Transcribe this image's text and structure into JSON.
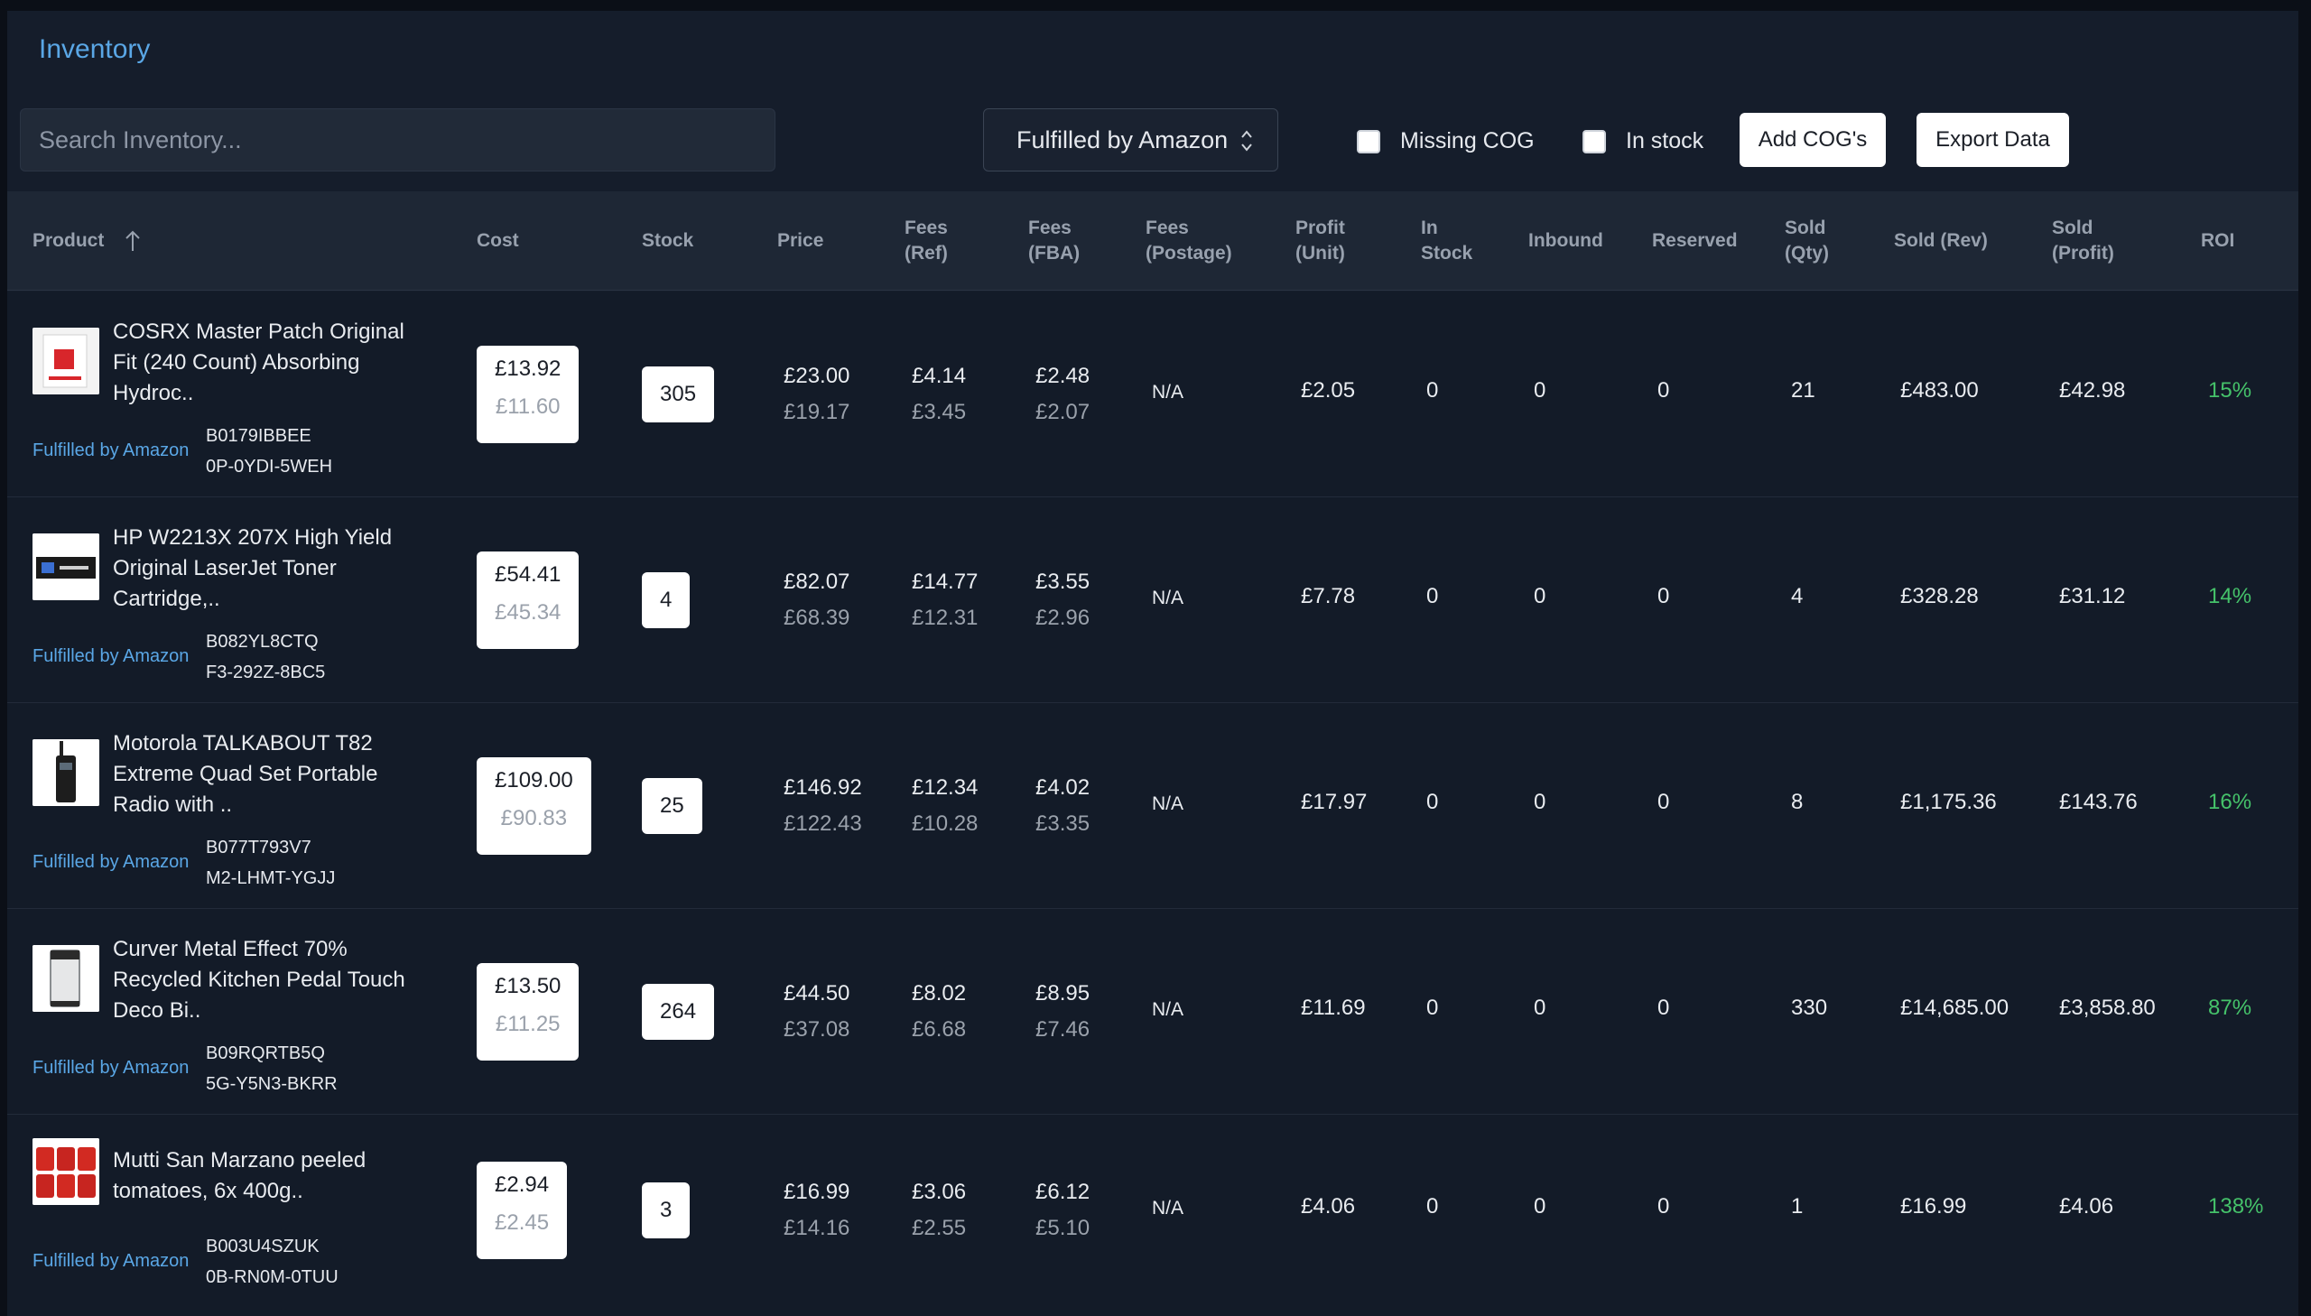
{
  "page": {
    "title": "Inventory"
  },
  "toolbar": {
    "search_placeholder": "Search Inventory...",
    "filter_value": "Fulfilled by Amazon",
    "missing_cog_label": "Missing COG",
    "in_stock_label": "In stock",
    "add_cogs_label": "Add COG's",
    "export_label": "Export Data"
  },
  "columns": {
    "product": "Product",
    "cost": "Cost",
    "stock": "Stock",
    "price": "Price",
    "fees_ref": [
      "Fees",
      "(Ref)"
    ],
    "fees_fba": [
      "Fees",
      "(FBA)"
    ],
    "fees_postage": [
      "Fees",
      "(Postage)"
    ],
    "profit_unit": [
      "Profit",
      "(Unit)"
    ],
    "in_stock": [
      "In",
      "Stock"
    ],
    "inbound": "Inbound",
    "reserved": "Reserved",
    "sold_qty": [
      "Sold",
      "(Qty)"
    ],
    "sold_rev": "Sold (Rev)",
    "sold_profit": [
      "Sold",
      "(Profit)"
    ],
    "roi": "ROI"
  },
  "rows": [
    {
      "name_lines": [
        "COSRX Master Patch Original",
        "Fit (240 Count) Absorbing",
        "Hydroc.."
      ],
      "fulfillment": "Fulfilled by Amazon",
      "asin": "B0179IBBEE",
      "sku": "0P-0YDI-5WEH",
      "cost": "£13.92",
      "cost_ex": "£11.60",
      "stock": "305",
      "price": "£23.00",
      "price_ex": "£19.17",
      "fees_ref": "£4.14",
      "fees_ref_ex": "£3.45",
      "fees_fba": "£2.48",
      "fees_fba_ex": "£2.07",
      "fees_postage": "N/A",
      "profit_unit": "£2.05",
      "in_stock": "0",
      "inbound": "0",
      "reserved": "0",
      "sold_qty": "21",
      "sold_rev": "£483.00",
      "sold_profit": "£42.98",
      "roi": "15%",
      "thumb": "patch-box-image"
    },
    {
      "name_lines": [
        "HP W2213X 207X High Yield",
        "Original LaserJet Toner",
        "Cartridge,.."
      ],
      "fulfillment": "Fulfilled by Amazon",
      "asin": "B082YL8CTQ",
      "sku": "F3-292Z-8BC5",
      "cost": "£54.41",
      "cost_ex": "£45.34",
      "stock": "4",
      "price": "£82.07",
      "price_ex": "£68.39",
      "fees_ref": "£14.77",
      "fees_ref_ex": "£12.31",
      "fees_fba": "£3.55",
      "fees_fba_ex": "£2.96",
      "fees_postage": "N/A",
      "profit_unit": "£7.78",
      "in_stock": "0",
      "inbound": "0",
      "reserved": "0",
      "sold_qty": "4",
      "sold_rev": "£328.28",
      "sold_profit": "£31.12",
      "roi": "14%",
      "thumb": "toner-box-image"
    },
    {
      "name_lines": [
        "Motorola TALKABOUT T82",
        "Extreme Quad Set Portable",
        "Radio with .."
      ],
      "fulfillment": "Fulfilled by Amazon",
      "asin": "B077T793V7",
      "sku": "M2-LHMT-YGJJ",
      "cost": "£109.00",
      "cost_ex": "£90.83",
      "stock": "25",
      "price": "£146.92",
      "price_ex": "£122.43",
      "fees_ref": "£12.34",
      "fees_ref_ex": "£10.28",
      "fees_fba": "£4.02",
      "fees_fba_ex": "£3.35",
      "fees_postage": "N/A",
      "profit_unit": "£17.97",
      "in_stock": "0",
      "inbound": "0",
      "reserved": "0",
      "sold_qty": "8",
      "sold_rev": "£1,175.36",
      "sold_profit": "£143.76",
      "roi": "16%",
      "thumb": "radio-image"
    },
    {
      "name_lines": [
        "Curver Metal Effect 70%",
        "Recycled Kitchen Pedal Touch",
        "Deco Bi.."
      ],
      "fulfillment": "Fulfilled by Amazon",
      "asin": "B09RQRTB5Q",
      "sku": "5G-Y5N3-BKRR",
      "cost": "£13.50",
      "cost_ex": "£11.25",
      "stock": "264",
      "price": "£44.50",
      "price_ex": "£37.08",
      "fees_ref": "£8.02",
      "fees_ref_ex": "£6.68",
      "fees_fba": "£8.95",
      "fees_fba_ex": "£7.46",
      "fees_postage": "N/A",
      "profit_unit": "£11.69",
      "in_stock": "0",
      "inbound": "0",
      "reserved": "0",
      "sold_qty": "330",
      "sold_rev": "£14,685.00",
      "sold_profit": "£3,858.80",
      "roi": "87%",
      "thumb": "bin-image"
    },
    {
      "name_lines": [
        "Mutti San Marzano peeled",
        "tomatoes, 6x 400g.."
      ],
      "fulfillment": "Fulfilled by Amazon",
      "asin": "B003U4SZUK",
      "sku": "0B-RN0M-0TUU",
      "cost": "£2.94",
      "cost_ex": "£2.45",
      "stock": "3",
      "price": "£16.99",
      "price_ex": "£14.16",
      "fees_ref": "£3.06",
      "fees_ref_ex": "£2.55",
      "fees_fba": "£6.12",
      "fees_fba_ex": "£5.10",
      "fees_postage": "N/A",
      "profit_unit": "£4.06",
      "in_stock": "0",
      "inbound": "0",
      "reserved": "0",
      "sold_qty": "1",
      "sold_rev": "£16.99",
      "sold_profit": "£4.06",
      "roi": "138%",
      "thumb": "tomato-cans-image"
    }
  ]
}
